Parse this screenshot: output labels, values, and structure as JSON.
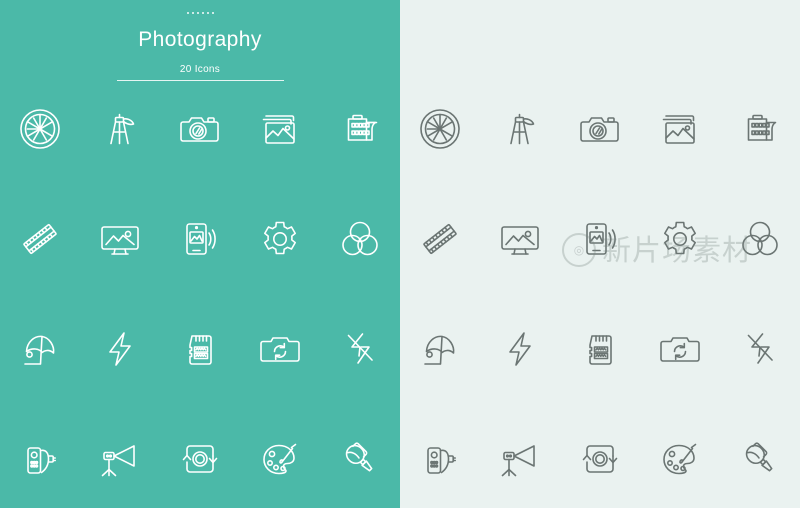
{
  "header": {
    "dots": "......",
    "title": "Photography",
    "subtitle": "20 Icons"
  },
  "colors": {
    "left_panel_bg": "#4bb9a8",
    "right_panel_bg": "#eaf2f0",
    "left_icon_stroke": "#ffffff",
    "right_icon_stroke": "#6b7573",
    "watermark": "#788482"
  },
  "watermark": {
    "logo_glyph": "◎",
    "text": "新片场素材"
  },
  "icons": [
    {
      "name": "aperture-icon",
      "label": "Aperture"
    },
    {
      "name": "tripod-icon",
      "label": "Tripod"
    },
    {
      "name": "camera-icon",
      "label": "Camera"
    },
    {
      "name": "photo-stack-icon",
      "label": "Photo Stack"
    },
    {
      "name": "film-roll-icon",
      "label": "Film Roll"
    },
    {
      "name": "film-strip-icon",
      "label": "Film Strip"
    },
    {
      "name": "desktop-photo-icon",
      "label": "Desktop Photo"
    },
    {
      "name": "mobile-photo-icon",
      "label": "Mobile Photo Share"
    },
    {
      "name": "settings-gear-icon",
      "label": "Settings"
    },
    {
      "name": "color-circles-icon",
      "label": "Color Channels"
    },
    {
      "name": "beach-umbrella-icon",
      "label": "Umbrella Reflector"
    },
    {
      "name": "flash-bolt-icon",
      "label": "Flash"
    },
    {
      "name": "memory-card-icon",
      "label": "Memory Card"
    },
    {
      "name": "camera-refresh-icon",
      "label": "Camera Refresh"
    },
    {
      "name": "flash-off-icon",
      "label": "Flash Off"
    },
    {
      "name": "remote-shutter-icon",
      "label": "Remote Shutter"
    },
    {
      "name": "studio-light-icon",
      "label": "Studio Light"
    },
    {
      "name": "rotate-lens-icon",
      "label": "Rotate Lens"
    },
    {
      "name": "palette-icon",
      "label": "Palette"
    },
    {
      "name": "microphone-icon",
      "label": "Microphone"
    }
  ]
}
